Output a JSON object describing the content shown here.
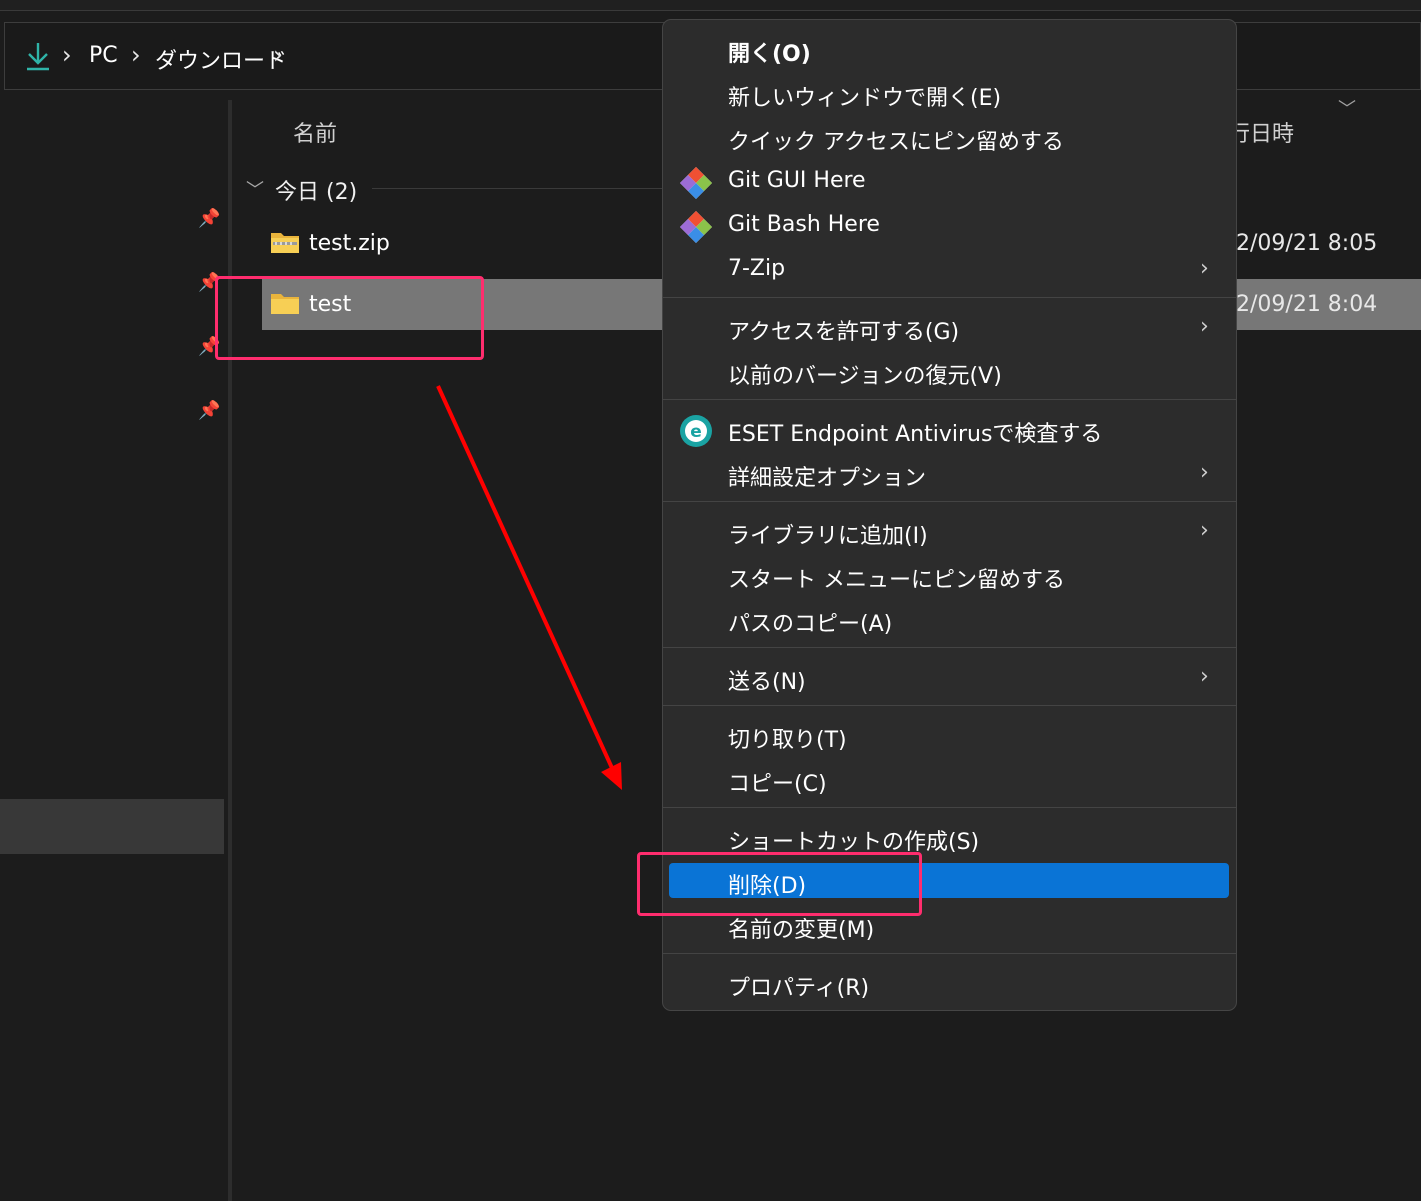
{
  "address_bar": {
    "icon": "download-arrow-icon",
    "crumbs": [
      "PC",
      "ダウンロード"
    ],
    "separator": "›"
  },
  "nav_pane": {
    "pins": [
      "pin-icon",
      "pin-icon",
      "pin-icon",
      "pin-icon"
    ]
  },
  "file_list": {
    "columns": {
      "name": "名前",
      "date": "行日時"
    },
    "group": {
      "label": "今日 (2)"
    },
    "files": [
      {
        "name": "test.zip",
        "date": "2/09/21 8:05",
        "icon": "zip-folder-icon"
      },
      {
        "name": "test",
        "date": "2/09/21 8:04",
        "icon": "folder-icon",
        "selected": true
      }
    ]
  },
  "context_menu": {
    "items": [
      {
        "label": "開く(O)",
        "bold": true
      },
      {
        "label": "新しいウィンドウで開く(E)"
      },
      {
        "label": "クイック アクセスにピン留めする"
      },
      {
        "label": "Git GUI Here",
        "icon": "git-icon"
      },
      {
        "label": "Git Bash Here",
        "icon": "git-icon"
      },
      {
        "label": "7-Zip",
        "submenu": true
      },
      {
        "label": "アクセスを許可する(G)",
        "submenu": true
      },
      {
        "label": "以前のバージョンの復元(V)"
      },
      {
        "label": "ESET Endpoint Antivirusで検査する",
        "icon": "eset-icon"
      },
      {
        "label": "詳細設定オプション",
        "submenu": true
      },
      {
        "label": "ライブラリに追加(I)",
        "submenu": true
      },
      {
        "label": "スタート メニューにピン留めする"
      },
      {
        "label": "パスのコピー(A)"
      },
      {
        "label": "送る(N)",
        "submenu": true
      },
      {
        "label": "切り取り(T)"
      },
      {
        "label": "コピー(C)"
      },
      {
        "label": "ショートカットの作成(S)"
      },
      {
        "label": "削除(D)",
        "highlighted": true
      },
      {
        "label": "名前の変更(M)"
      },
      {
        "label": "プロパティ(R)"
      }
    ],
    "submenu_glyph": "›"
  },
  "colors": {
    "background": "#1c1c1c",
    "menu_background": "#2c2c2c",
    "highlight_blue": "#0a74d6",
    "annotation_pink": "#ff2d6e",
    "arrow_red": "#ff0000",
    "selected_row": "#777777"
  }
}
